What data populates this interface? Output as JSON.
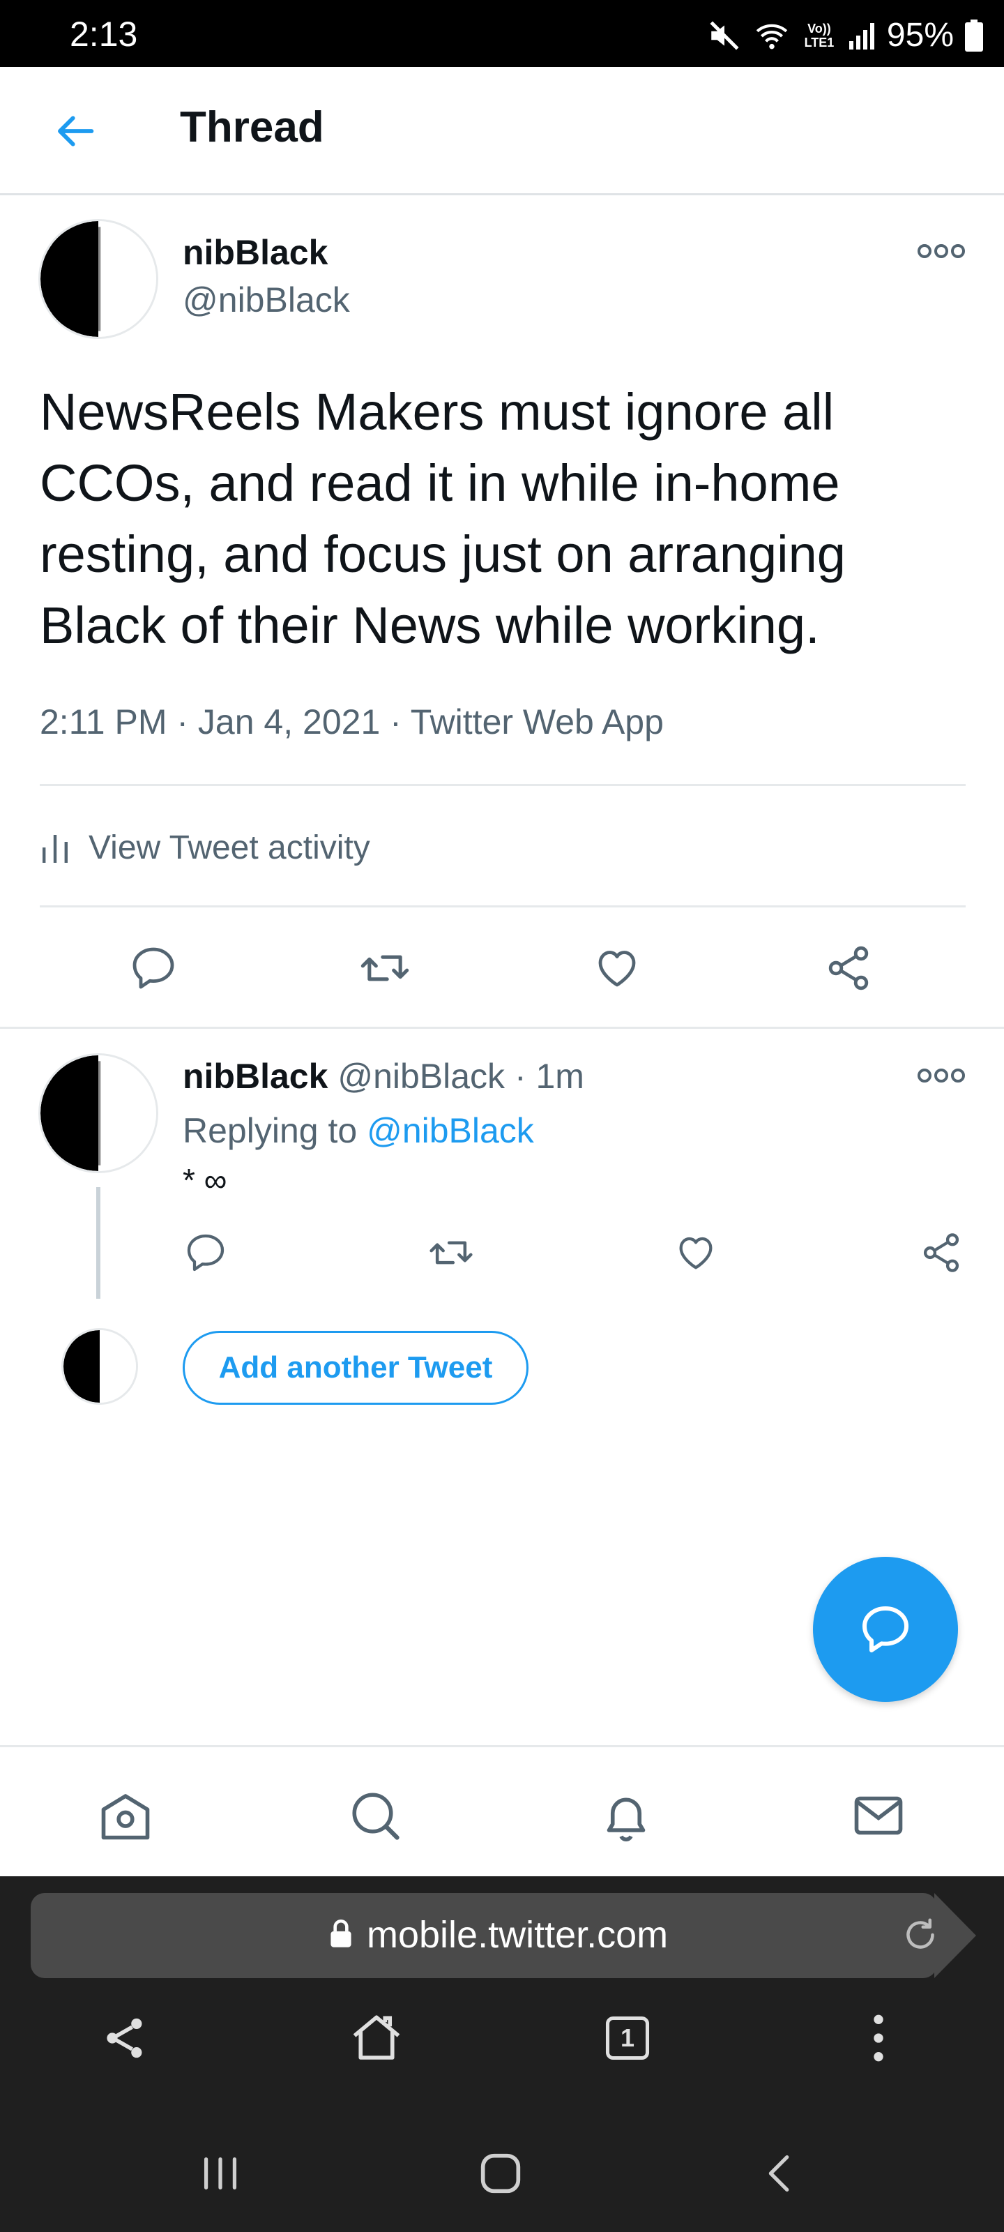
{
  "status_bar": {
    "time": "2:13",
    "battery": "95%",
    "network_label": "Vo)) LTE1"
  },
  "header": {
    "title": "Thread"
  },
  "main_tweet": {
    "name": "nibBlack",
    "handle": "@nibBlack",
    "text": "NewsReels Makers must ignore all CCOs, and read it in while in-home resting, and focus just on arranging Black of their News while working.",
    "meta": "2:11 PM · Jan 4, 2021 · Twitter Web App",
    "activity_label": "View Tweet activity"
  },
  "reply_tweet": {
    "name": "nibBlack",
    "handle_time": "@nibBlack · 1m",
    "replying_prefix": "Replying to",
    "replying_handle": "@nibBlack",
    "text": "* ∞"
  },
  "compose": {
    "add_label": "Add another Tweet"
  },
  "browser": {
    "url": "mobile.twitter.com",
    "tab_count": "1"
  },
  "colors": {
    "accent": "#1d9bf0",
    "secondary_text": "#536471",
    "browser_bg": "#1f1f1f"
  },
  "icons": {
    "back": "arrow-left-icon",
    "more": "more-dots-icon",
    "reply": "reply-icon",
    "retweet": "retweet-icon",
    "like": "heart-icon",
    "share": "share-icon",
    "fab": "compose-icon",
    "home": "home-icon",
    "search": "search-icon",
    "notifications": "bell-icon",
    "messages": "mail-icon"
  }
}
